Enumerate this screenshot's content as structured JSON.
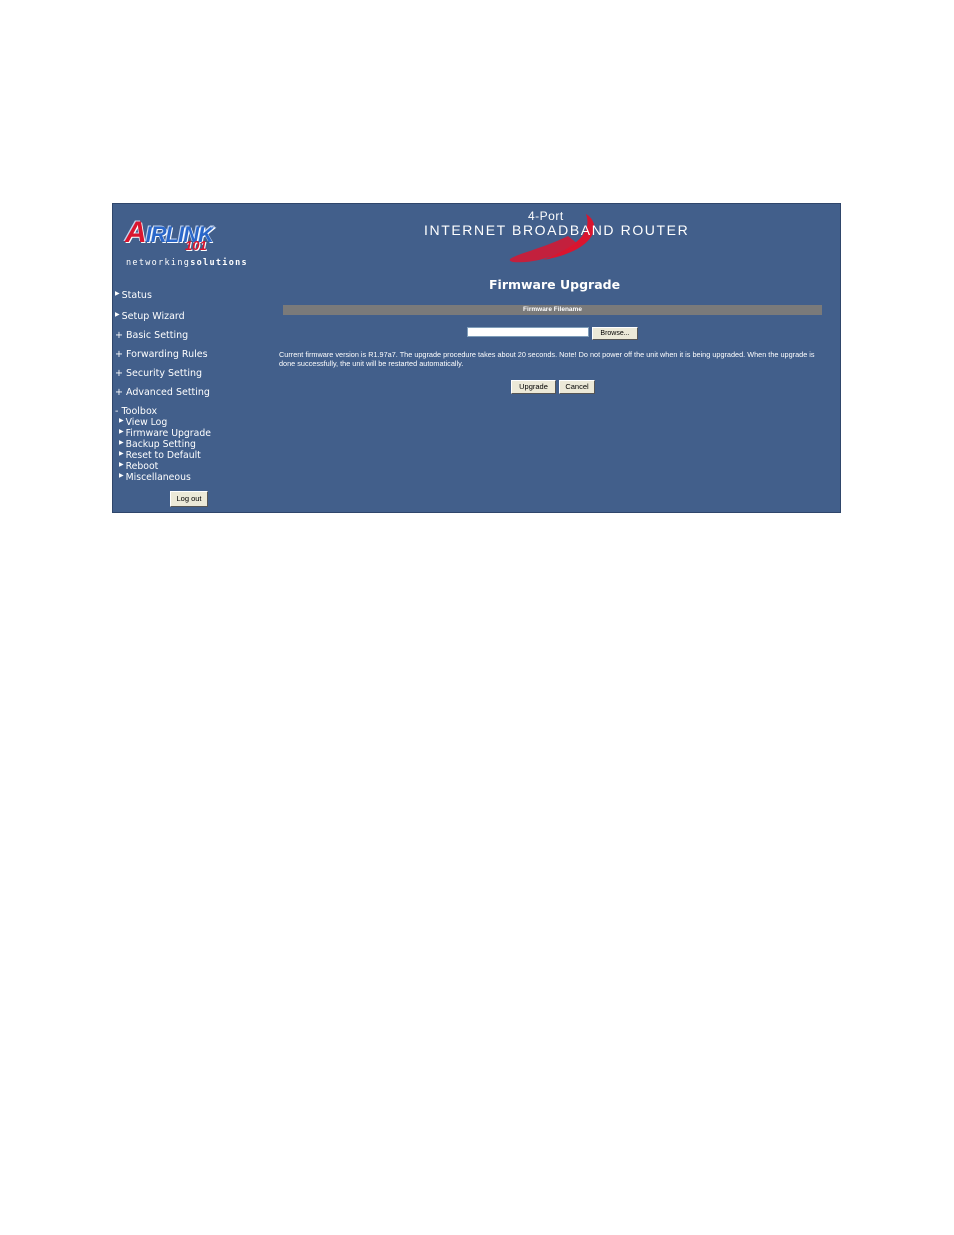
{
  "logo": {
    "brand_a": "A",
    "brand_rest": "IRLINK",
    "number": "101",
    "tm": "™"
  },
  "tagline": {
    "part1": "networking",
    "part2": "solutions"
  },
  "header": {
    "line1": "4-Port",
    "line2": "INTERNET BROADBAND ROUTER"
  },
  "sidebar": {
    "items": [
      {
        "marker": "▶",
        "label": "Status"
      },
      {
        "marker": "▶",
        "label": "Setup Wizard"
      },
      {
        "marker": "+",
        "label": "Basic Setting"
      },
      {
        "marker": "+",
        "label": "Forwarding Rules"
      },
      {
        "marker": "+",
        "label": "Security Setting"
      },
      {
        "marker": "+",
        "label": "Advanced Setting"
      },
      {
        "marker": "-",
        "label": "Toolbox"
      }
    ],
    "toolbox_items": [
      {
        "marker": "▶",
        "label": "View Log"
      },
      {
        "marker": "▶",
        "label": "Firmware Upgrade"
      },
      {
        "marker": "▶",
        "label": "Backup Setting"
      },
      {
        "marker": "▶",
        "label": "Reset to Default"
      },
      {
        "marker": "▶",
        "label": "Reboot"
      },
      {
        "marker": "▶",
        "label": "Miscellaneous"
      }
    ],
    "logout": "Log out"
  },
  "main": {
    "title": "Firmware Upgrade",
    "bar_label": "Firmware Filename",
    "file_value": "",
    "browse": "Browse...",
    "message": "Current firmware version is R1.97a7. The upgrade procedure takes about 20 seconds. Note! Do not power off the unit when it is being upgraded. When the upgrade is done successfully, the unit will be restarted automatically.",
    "upgrade": "Upgrade",
    "cancel": "Cancel"
  }
}
